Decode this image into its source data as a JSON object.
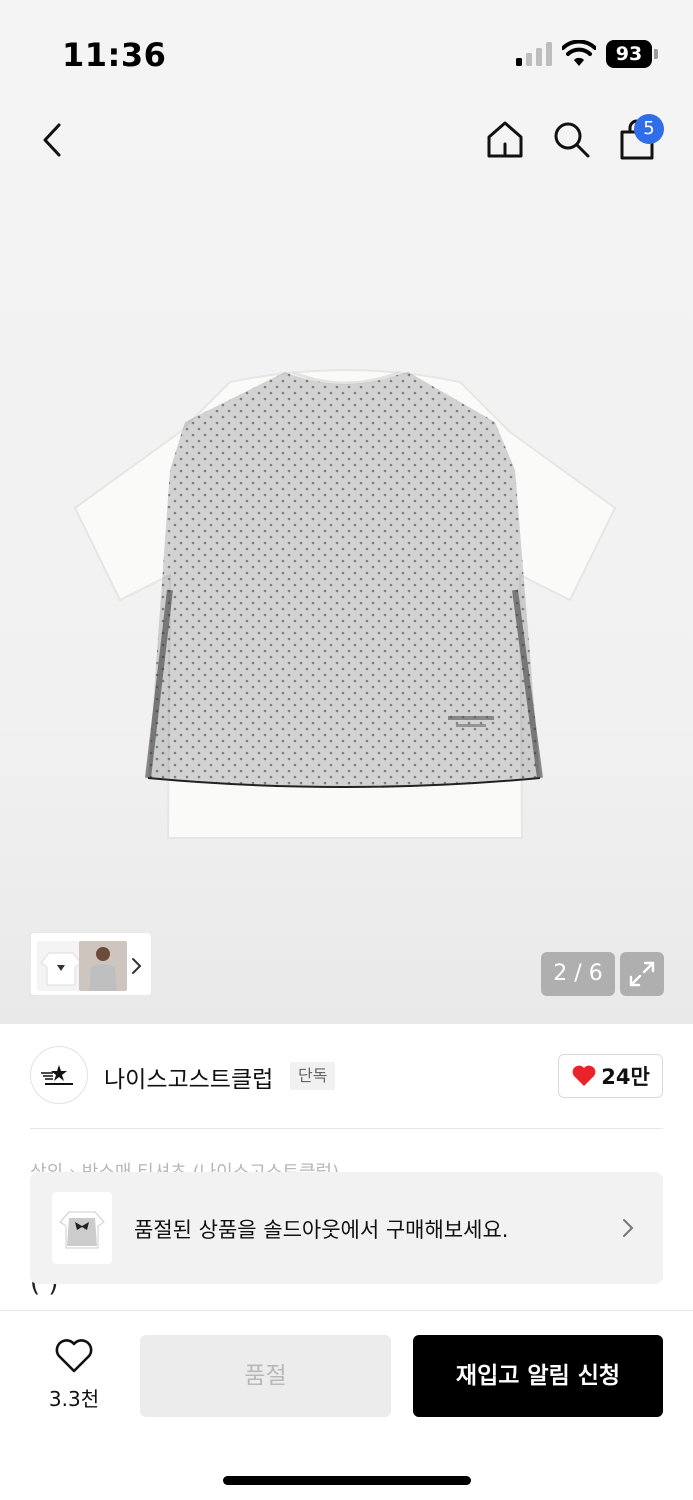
{
  "status_bar": {
    "time": "11:36",
    "battery": "93"
  },
  "nav": {
    "cart_badge": "5"
  },
  "gallery": {
    "counter": "2 / 6"
  },
  "brand": {
    "name": "나이스고스트클럽",
    "badge": "단독",
    "likes": "24만",
    "heart_color": "#e8242a"
  },
  "product": {
    "breadcrumb_partial": "상의 › 반소매 티셔츠 (나이스고스트클럽)",
    "title_partial": "(                              )"
  },
  "soldout_banner": {
    "text": "품절된 상품을 솔드아웃에서 구매해보세요."
  },
  "bottom_bar": {
    "wish_count": "3.3천",
    "soldout_label": "품절",
    "restock_label": "재입고 알림 신청"
  },
  "colors": {
    "accent": "#2f6ee8",
    "primary_button": "#000000",
    "disabled_button": "#ececec"
  }
}
